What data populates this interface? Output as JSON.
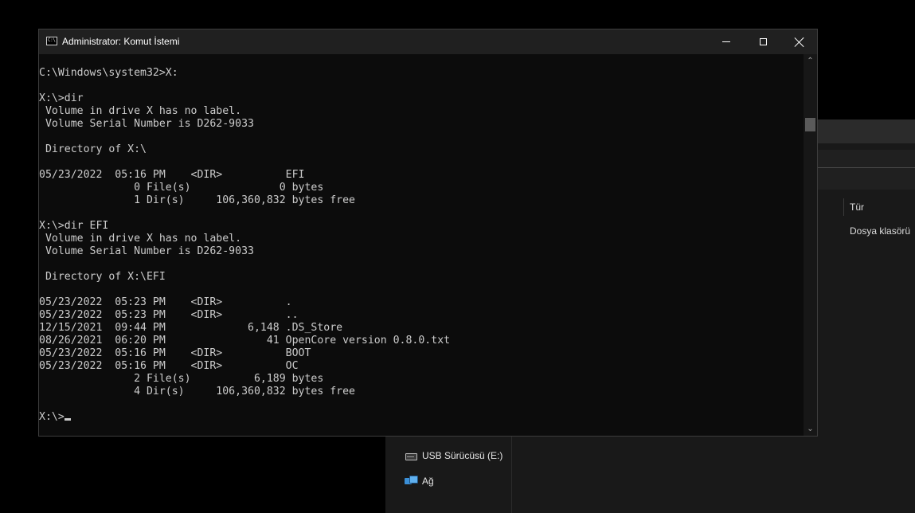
{
  "explorer": {
    "column_type_header": "Tür",
    "row_type_value": "Dosya klasörü",
    "nav_items": [
      {
        "label": "USB Sürücüsü (E:)",
        "icon": "usb-drive-icon"
      },
      {
        "label": "Ağ",
        "icon": "network-icon"
      }
    ]
  },
  "cmd": {
    "title": "Administrator: Komut İstemi",
    "icon_text": "C:\\",
    "lines": [
      "",
      "C:\\Windows\\system32>X:",
      "",
      "X:\\>dir",
      " Volume in drive X has no label.",
      " Volume Serial Number is D262-9033",
      "",
      " Directory of X:\\",
      "",
      "05/23/2022  05:16 PM    <DIR>          EFI",
      "               0 File(s)              0 bytes",
      "               1 Dir(s)     106,360,832 bytes free",
      "",
      "X:\\>dir EFI",
      " Volume in drive X has no label.",
      " Volume Serial Number is D262-9033",
      "",
      " Directory of X:\\EFI",
      "",
      "05/23/2022  05:23 PM    <DIR>          .",
      "05/23/2022  05:23 PM    <DIR>          ..",
      "12/15/2021  09:44 PM             6,148 .DS_Store",
      "08/26/2021  06:20 PM                41 OpenCore version 0.8.0.txt",
      "05/23/2022  05:16 PM    <DIR>          BOOT",
      "05/23/2022  05:16 PM    <DIR>          OC",
      "               2 File(s)          6,189 bytes",
      "               4 Dir(s)     106,360,832 bytes free",
      ""
    ],
    "prompt": "X:\\>"
  },
  "colors": {
    "console_bg": "#0c0c0c",
    "console_fg": "#cccccc",
    "titlebar_bg": "#202020"
  }
}
